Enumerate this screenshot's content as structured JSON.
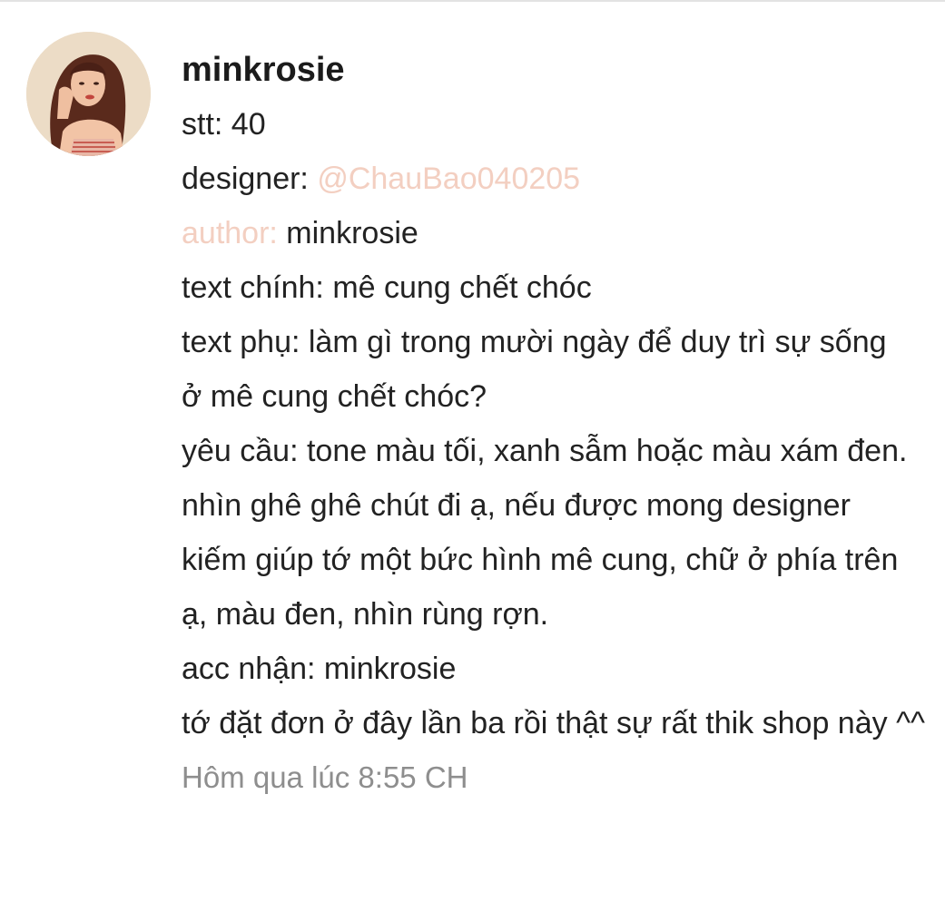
{
  "comment": {
    "username": "minkrosie",
    "lines": {
      "stt": "stt: 40",
      "designer_label": "designer: ",
      "designer_mention": "@ChauBao040205",
      "author_label": "author:",
      "author_value": " minkrosie",
      "text_chinh": "text chính: mê cung chết chóc",
      "text_phu": "text phụ: làm gì trong mười ngày để duy trì sự sống ở mê cung chết chóc?",
      "yeu_cau": "yêu cầu: tone màu tối, xanh sẫm hoặc màu xám đen. nhìn ghê ghê chút đi ạ, nếu được mong designer kiếm giúp tớ một bức hình mê cung, chữ ở phía trên ạ, màu đen, nhìn rùng rợn.",
      "acc_nhan": "acc nhận: minkrosie",
      "note": "tớ đặt đơn ở đây lần ba rồi thật sự rất thik shop này ^^"
    },
    "timestamp": "Hôm qua lúc 8:55 CH"
  },
  "colors": {
    "mention": "#f3cfc1",
    "text": "#222222",
    "timestamp": "#8e8e8e"
  }
}
